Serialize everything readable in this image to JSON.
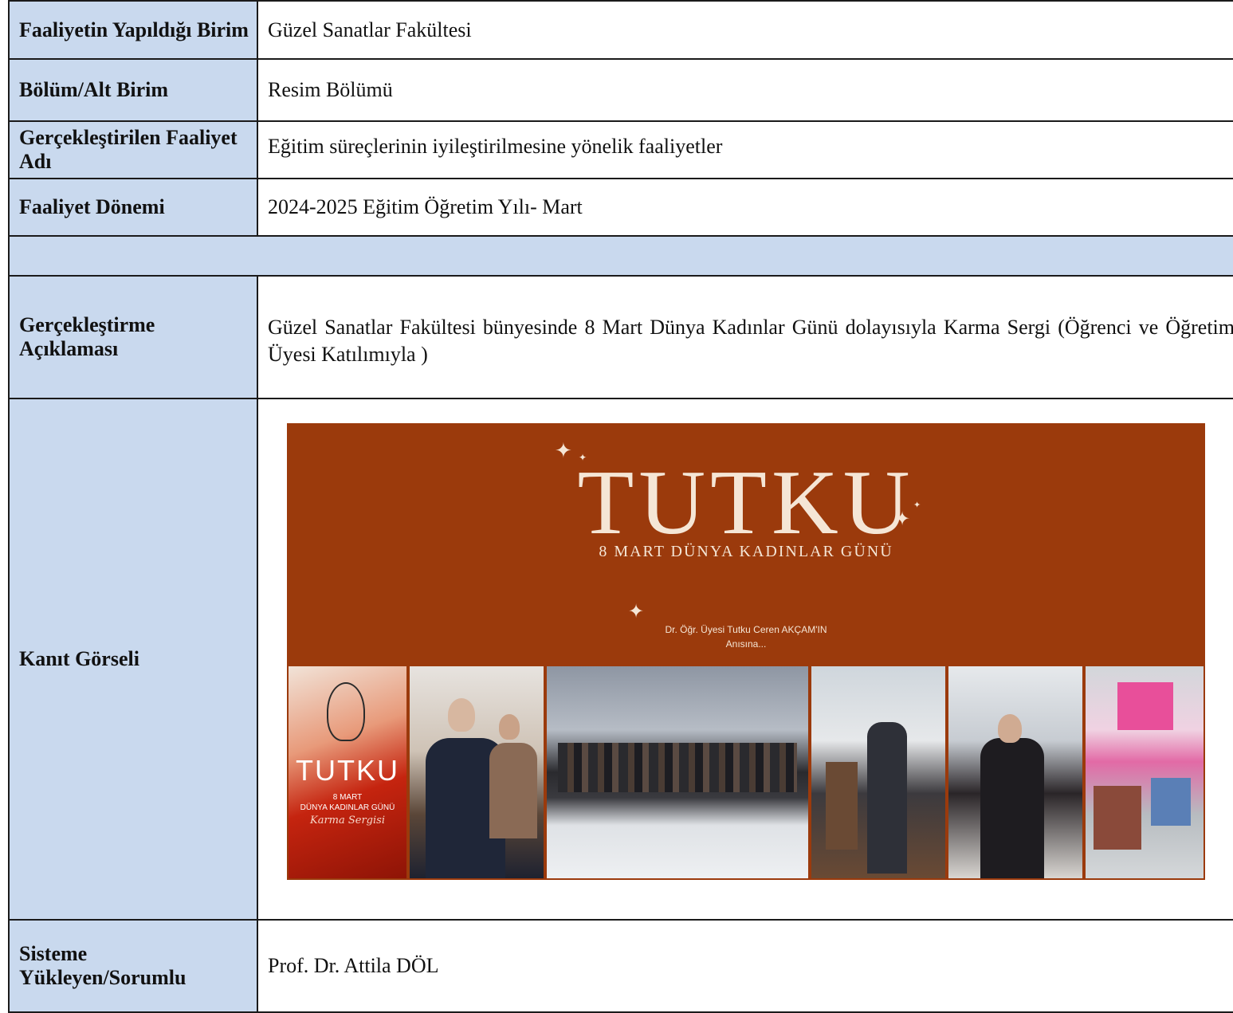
{
  "rows": [
    {
      "label": "Faaliyetin Yapıldığı Birim",
      "value": "Güzel Sanatlar Fakültesi"
    },
    {
      "label": "Bölüm/Alt Birim",
      "value": "Resim Bölümü"
    },
    {
      "label": "Gerçekleştirilen Faaliyet Adı",
      "value": "Eğitim süreçlerinin iyileştirilmesine yönelik faaliyetler"
    },
    {
      "label": "Faaliyet Dönemi",
      "value": "2024-2025 Eğitim Öğretim Yılı- Mart"
    },
    {
      "label": "Gerçekleştirme Açıklaması",
      "value": "Güzel Sanatlar Fakültesi bünyesinde 8 Mart Dünya Kadınlar Günü dolayısıyla Karma Sergi (Öğrenci ve Öğretim Üyesi Katılımıyla )"
    },
    {
      "label": "Kanıt Görseli",
      "value": ""
    },
    {
      "label": "Sisteme Yükleyen/Sorumlu",
      "value": "Prof. Dr. Attila DÖL"
    }
  ],
  "evidence": {
    "banner_title": "TUTKU",
    "banner_subtitle": "8 MART DÜNYA KADINLAR GÜNÜ",
    "banner_credit_line1": "Dr. Öğr. Üyesi Tutku Ceren AKÇAM'IN",
    "banner_credit_line2": "Anısına...",
    "poster_title": "TUTKU",
    "poster_line1": "8 MART",
    "poster_line2": "DÜNYA KADINLAR GÜNÜ",
    "poster_script": "Karma Sergisi",
    "banner_color": "#9b3a0c"
  },
  "colors": {
    "label_bg": "#c9d9ee",
    "border": "#1a1a1a"
  }
}
